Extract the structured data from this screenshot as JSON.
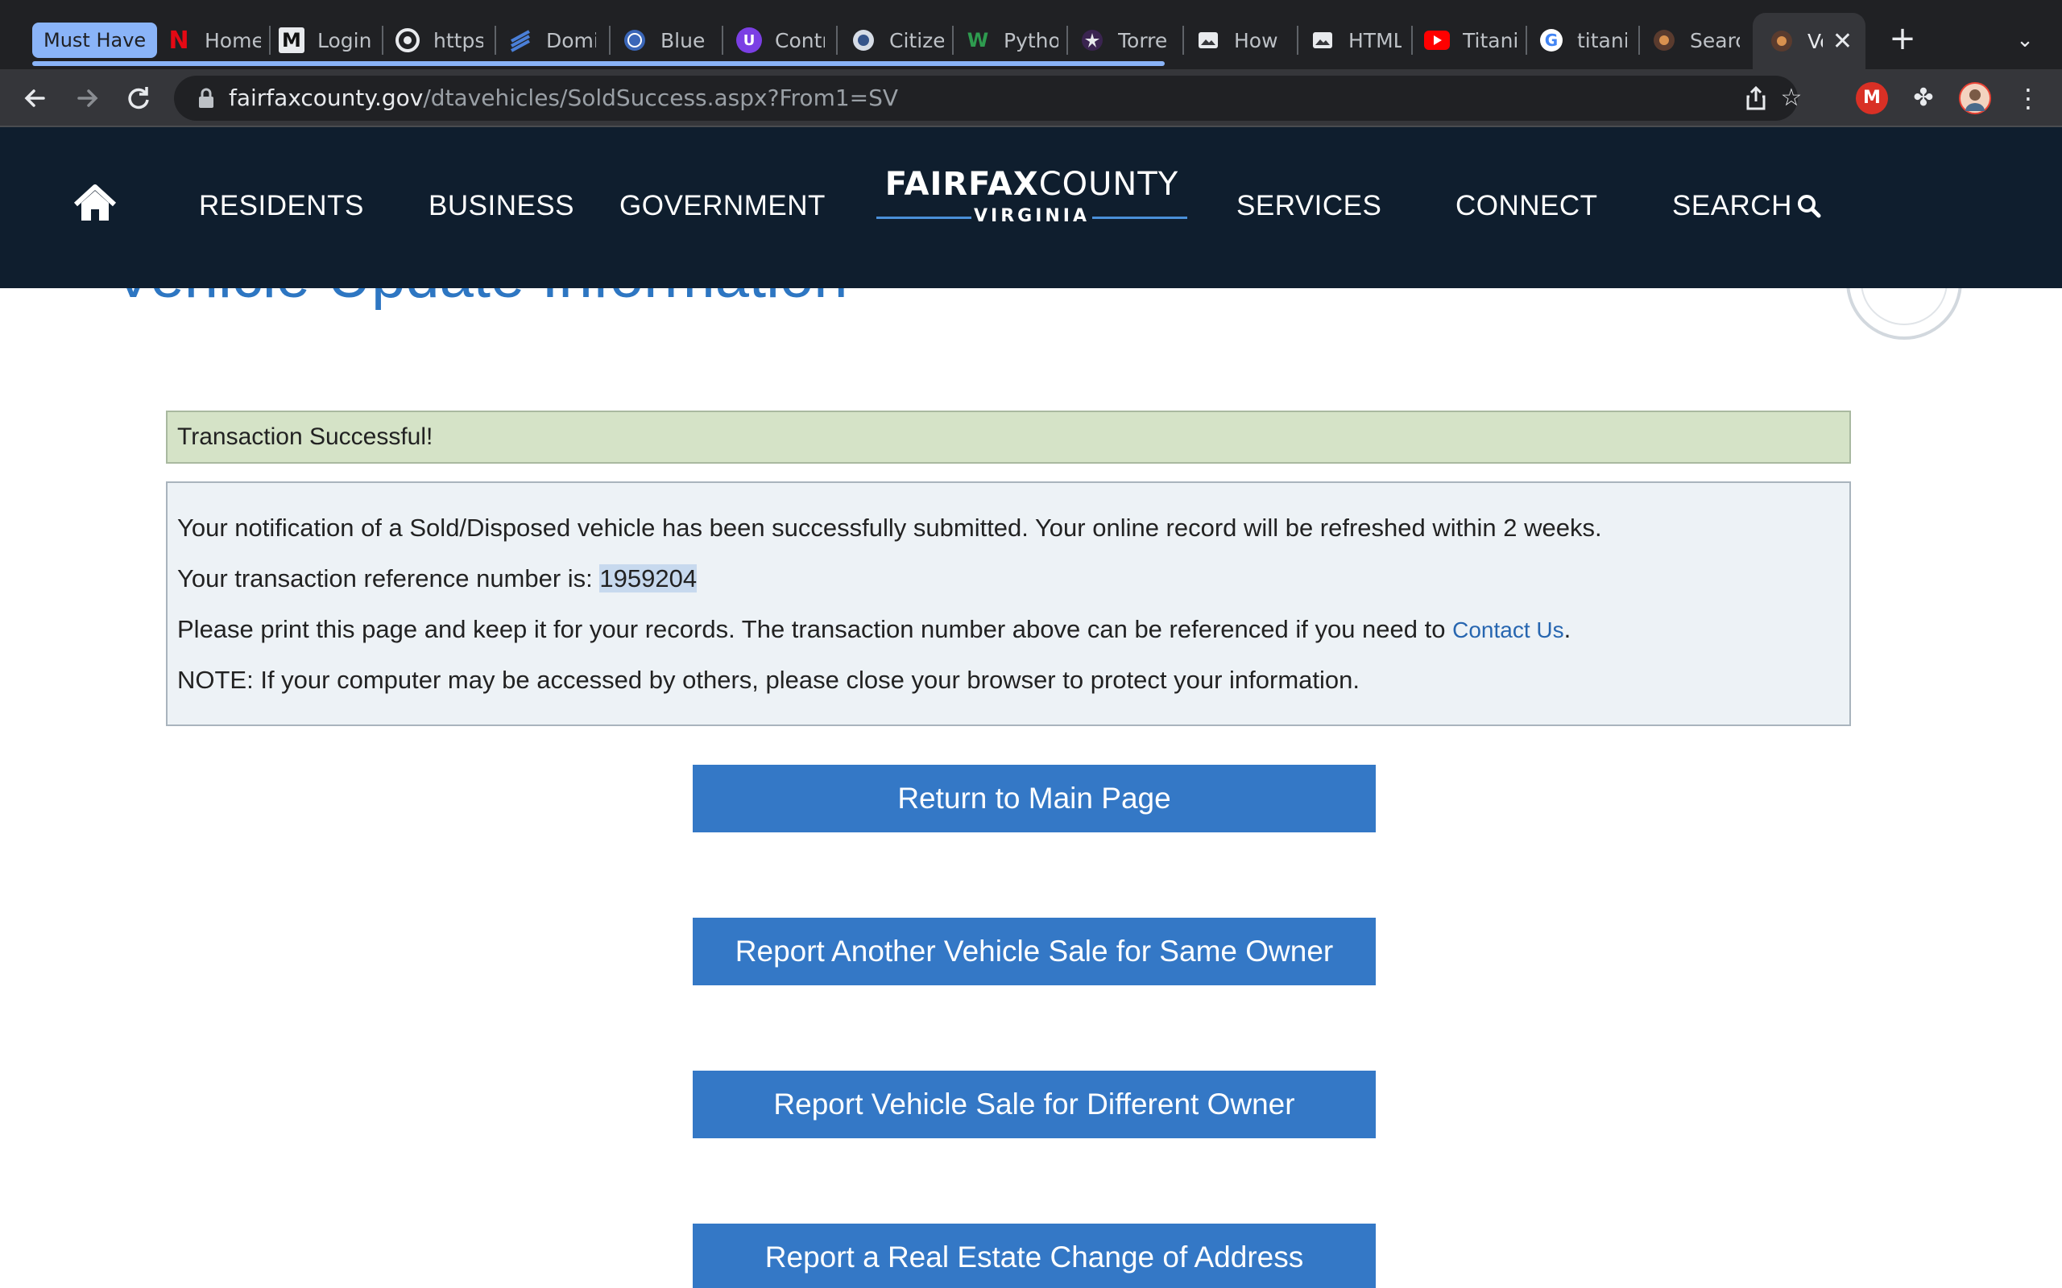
{
  "browser": {
    "tab_group_label": "Must Have",
    "tabs": [
      {
        "title": "Home",
        "icon": "netflix-icon"
      },
      {
        "title": "Login",
        "icon": "medium-icon"
      },
      {
        "title": "https",
        "icon": "chrome-icon"
      },
      {
        "title": "Domi",
        "icon": "layers-icon"
      },
      {
        "title": "Blue",
        "icon": "globe-icon"
      },
      {
        "title": "Contr",
        "icon": "u-icon"
      },
      {
        "title": "Citize",
        "icon": "seal-icon"
      },
      {
        "title": "Pytho",
        "icon": "w-icon"
      },
      {
        "title": "Torre",
        "icon": "torrent-icon"
      },
      {
        "title": "How",
        "icon": "image-icon"
      },
      {
        "title": "HTML",
        "icon": "image-icon"
      },
      {
        "title": "Titani",
        "icon": "youtube-icon"
      },
      {
        "title": "titani",
        "icon": "google-icon"
      },
      {
        "title": "Searc",
        "icon": "fairfax-icon"
      }
    ],
    "active_tab": {
      "title": "Ve",
      "icon": "fairfax-icon"
    },
    "url_host": "fairfaxcounty.gov",
    "url_path": "/dtavehicles/SoldSuccess.aspx?From1=SV",
    "accent": "#8ab4f8"
  },
  "site": {
    "nav": {
      "residents": "RESIDENTS",
      "business": "BUSINESS",
      "government": "GOVERNMENT",
      "services": "SERVICES",
      "connect": "CONNECT",
      "search": "SEARCH"
    },
    "logo": {
      "part1": "FAIRFAX",
      "part2": "COUNTY",
      "sub": "VIRGINIA"
    },
    "header_bg": "#0f1e2e"
  },
  "content": {
    "heading": "Vehicle Update Information",
    "success_message": "Transaction Successful!",
    "line1": "Your notification of a Sold/Disposed  vehicle has been successfully submitted. Your online record will be refreshed within 2 weeks.",
    "line2_prefix": "Your transaction reference number is: ",
    "reference_number": "1959204",
    "line3_prefix": "Please print this page and keep it for your records. The transaction number above can be referenced if you need to ",
    "contact_link": "Contact Us",
    "line3_suffix": ".",
    "line4": "NOTE: If your computer may be accessed by others, please close your browser to protect your information.",
    "buttons": {
      "return_main": "Return to Main Page",
      "same_owner": "Report Another Vehicle Sale for Same Owner",
      "different_owner": "Report Vehicle Sale for Different Owner",
      "address_change": "Report a Real Estate Change of Address"
    },
    "button_color": "#3478c6"
  }
}
